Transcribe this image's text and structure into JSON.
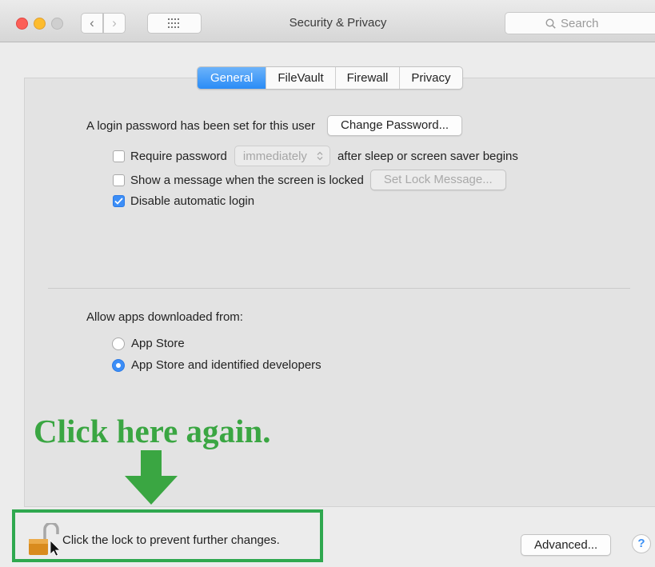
{
  "window": {
    "title": "Security & Privacy",
    "search_placeholder": "Search"
  },
  "tabs": [
    {
      "label": "General",
      "active": true
    },
    {
      "label": "FileVault",
      "active": false
    },
    {
      "label": "Firewall",
      "active": false
    },
    {
      "label": "Privacy",
      "active": false
    }
  ],
  "general": {
    "login_password_text": "A login password has been set for this user",
    "change_password_button": "Change Password...",
    "require_password": {
      "label": "Require password",
      "checked": false,
      "select_value": "immediately",
      "suffix": "after sleep or screen saver begins"
    },
    "show_message": {
      "label": "Show a message when the screen is locked",
      "checked": false,
      "button": "Set Lock Message..."
    },
    "disable_auto_login": {
      "label": "Disable automatic login",
      "checked": true
    }
  },
  "downloads": {
    "heading": "Allow apps downloaded from:",
    "options": [
      {
        "label": "App Store",
        "selected": false
      },
      {
        "label": "App Store and identified developers",
        "selected": true
      }
    ]
  },
  "annotation": {
    "callout_text": "Click here again.",
    "color": "#3aa642"
  },
  "footer": {
    "lock_text": "Click the lock to prevent further changes.",
    "advanced_button": "Advanced...",
    "help_label": "?"
  },
  "colors": {
    "accent": "#2a8cf6",
    "highlight_box": "#2fa84f"
  }
}
